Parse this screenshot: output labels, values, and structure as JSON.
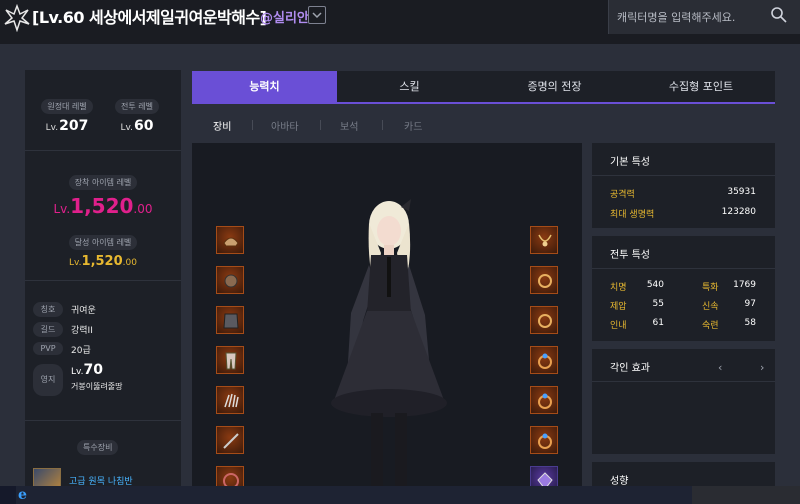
{
  "header": {
    "title": "[Lv.60 세상에서제일귀여운박해수]",
    "handle": "@실리안",
    "search_placeholder": "캐릭터명을 입력해주세요."
  },
  "profile": {
    "expedition_label": "원정대 레벨",
    "expedition_prefix": "Lv.",
    "expedition_value": "207",
    "combat_label": "전투 레벨",
    "combat_prefix": "Lv.",
    "combat_value": "60",
    "equip_item_label": "장착 아이템 레벨",
    "equip_prefix": "Lv.",
    "equip_int": "1,520",
    "equip_dec": ".00",
    "achieved_item_label": "달성 아이템 레벨",
    "achieved_prefix": "Lv.",
    "achieved_int": "1,520",
    "achieved_dec": ".00",
    "info": [
      {
        "key": "칭호",
        "value": "귀여운"
      },
      {
        "key": "길드",
        "value": "강력II"
      },
      {
        "key": "PVP",
        "value": "20급"
      }
    ],
    "realm_label": "영지",
    "realm_prefix": "Lv.",
    "realm_level": "70",
    "realm_name": "거봉이뚫려줄땅",
    "special_label": "특수장비",
    "special_item": "고급 원목 나침반"
  },
  "tabs": [
    "능력치",
    "스킬",
    "증명의 전장",
    "수집형 포인트"
  ],
  "active_tab": 0,
  "subtabs": [
    "장비",
    "아바타",
    "보석",
    "카드"
  ],
  "basic_stats": {
    "title": "기본 특성",
    "items": [
      {
        "label": "공격력",
        "value": "35931"
      },
      {
        "label": "최대 생명력",
        "value": "123280"
      }
    ]
  },
  "combat_stats": {
    "title": "전투 특성",
    "left": [
      {
        "label": "치명",
        "value": "540"
      },
      {
        "label": "제압",
        "value": "55"
      },
      {
        "label": "인내",
        "value": "61"
      }
    ],
    "right": [
      {
        "label": "특화",
        "value": "1769"
      },
      {
        "label": "신속",
        "value": "97"
      },
      {
        "label": "숙련",
        "value": "58"
      }
    ]
  },
  "engraving": {
    "title": "각인 효과",
    "prev": "‹",
    "next": "›"
  },
  "tendency": {
    "title": "성향"
  },
  "equipment_slots": {
    "left": [
      "helmet-icon",
      "shoulder-icon",
      "chest-icon",
      "pants-icon",
      "gloves-icon",
      "weapon-icon",
      "extra-icon"
    ],
    "right": [
      "necklace-icon",
      "earring-icon",
      "earring-icon",
      "ring-icon",
      "ring-icon",
      "ring-icon",
      "stone-icon"
    ]
  },
  "taskbar": {
    "ie_glyph": "e"
  }
}
